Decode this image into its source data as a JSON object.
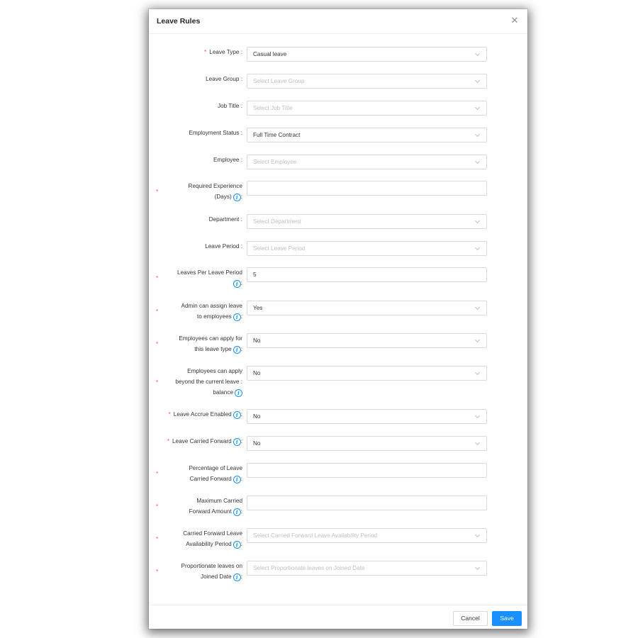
{
  "modal": {
    "title": "Leave Rules",
    "close_symbol": "✕",
    "cancel_label": "Cancel",
    "save_label": "Save",
    "accent_color": "#1890ff",
    "required_color": "#ff4d4f"
  },
  "fields": {
    "leave_type": {
      "label": "Leave Type :",
      "value": "Casual leave"
    },
    "leave_group": {
      "label": "Leave Group :",
      "placeholder": "Select Leave Group"
    },
    "job_title": {
      "label": "Job Title :",
      "placeholder": "Select Job Title"
    },
    "employment_status": {
      "label": "Employment Status :",
      "value": "Full Time Contract"
    },
    "employee": {
      "label": "Employee :",
      "placeholder": "Select Employee"
    },
    "required_experience": {
      "label_line1": "Required Experience",
      "label_line2": "(Days)",
      "value": ""
    },
    "department": {
      "label": "Department :",
      "placeholder": "Select Department"
    },
    "leave_period": {
      "label": "Leave Period :",
      "placeholder": "Select Leave Period"
    },
    "leaves_per_period": {
      "label_line1": "Leaves Per Leave Period",
      "value": "5"
    },
    "admin_assign": {
      "label_line1": "Admin can assign leave",
      "label_line2": "to employees",
      "value": "Yes"
    },
    "employee_apply": {
      "label_line1": "Employees can apply for",
      "label_line2": "this leave type",
      "value": "No"
    },
    "apply_beyond": {
      "label_line1": "Employees can apply",
      "label_line2": "beyond the current leave :",
      "label_line3": "balance",
      "value": "No"
    },
    "leave_accrue": {
      "label": "Leave Accrue Enabled",
      "value": "No"
    },
    "carried_forward": {
      "label": "Leave Carried Forward",
      "value": "No"
    },
    "percentage_cf": {
      "label_line1": "Percentage of Leave",
      "label_line2": "Carried Forward",
      "value": ""
    },
    "max_cf": {
      "label_line1": "Maximum Carried",
      "label_line2": "Forward Amount",
      "value": ""
    },
    "cf_availability": {
      "label_line1": "Carried Forward Leave",
      "label_line2": "Availability Period",
      "placeholder": "Select Carried Forward Leave Availability Period"
    },
    "proportionate": {
      "label_line1": "Proportionate leaves on",
      "label_line2": "Joined Date",
      "placeholder": "Select Proportionate leaves on Joined Date"
    }
  },
  "icons": {
    "info": "info-circle-icon",
    "chevron": "chevron-down-icon",
    "close": "close-icon"
  }
}
